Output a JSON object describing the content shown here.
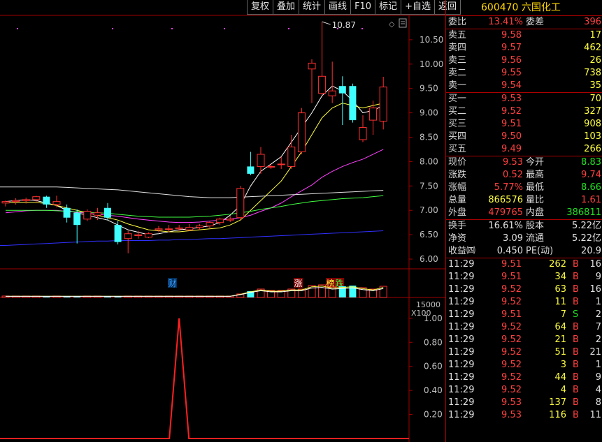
{
  "toolbar": {
    "buttons": [
      "复权",
      "叠加",
      "统计",
      "画线",
      "F10",
      "标记",
      "+自选",
      "返回"
    ]
  },
  "stock": {
    "code": "600470",
    "name": "六国化工"
  },
  "price_axis": [
    "10.50",
    "10.00",
    "9.50",
    "9.00",
    "8.50",
    "8.00",
    "7.50",
    "7.00",
    "6.50",
    "6.00"
  ],
  "high_marker": "10.87",
  "event_labels": [
    "财",
    "涨",
    "榜",
    "跌"
  ],
  "volume_axis": {
    "tick": "15000",
    "unit": "X100"
  },
  "indicator_axis": [
    "1.00",
    "0.80",
    "0.60",
    "0.40",
    "0.20"
  ],
  "wei": {
    "ratio_label": "委比",
    "ratio": "13.41%",
    "diff_label": "委差",
    "diff": "396"
  },
  "asks": [
    {
      "label": "卖五",
      "price": "9.58",
      "vol": "17"
    },
    {
      "label": "卖四",
      "price": "9.57",
      "vol": "462"
    },
    {
      "label": "卖三",
      "price": "9.56",
      "vol": "26"
    },
    {
      "label": "卖二",
      "price": "9.55",
      "vol": "738"
    },
    {
      "label": "卖一",
      "price": "9.54",
      "vol": "35"
    }
  ],
  "bids": [
    {
      "label": "买一",
      "price": "9.53",
      "vol": "70"
    },
    {
      "label": "买二",
      "price": "9.52",
      "vol": "327"
    },
    {
      "label": "买三",
      "price": "9.51",
      "vol": "908"
    },
    {
      "label": "买四",
      "price": "9.50",
      "vol": "103"
    },
    {
      "label": "买五",
      "price": "9.49",
      "vol": "266"
    }
  ],
  "quote": [
    {
      "l1": "现价",
      "v1": "9.53",
      "c1": "red",
      "l2": "今开",
      "v2": "8.83",
      "c2": "grn"
    },
    {
      "l1": "涨跌",
      "v1": "0.52",
      "c1": "red",
      "l2": "最高",
      "v2": "9.74",
      "c2": "red"
    },
    {
      "l1": "涨幅",
      "v1": "5.77%",
      "c1": "red",
      "l2": "最低",
      "v2": "8.66",
      "c2": "grn"
    },
    {
      "l1": "总量",
      "v1": "866576",
      "c1": "yel",
      "l2": "量比",
      "v2": "1.61",
      "c2": "red"
    },
    {
      "l1": "外盘",
      "v1": "479765",
      "c1": "red",
      "l2": "内盘",
      "v2": "386811",
      "c2": "grn"
    }
  ],
  "fund": [
    {
      "l1": "换手",
      "v1": "16.61%",
      "l2": "股本",
      "v2": "5.22亿"
    },
    {
      "l1": "净资",
      "v1": "3.09",
      "l2": "流通",
      "v2": "5.22亿"
    },
    {
      "l1": "收益㈣",
      "v1": "0.450",
      "l2": "PE(动)",
      "v2": "20.9"
    }
  ],
  "ticks": [
    {
      "time": "11:29",
      "price": "9.51",
      "vol": "262",
      "bs": "B",
      "n": "16",
      "pc": "red",
      "bc": "red"
    },
    {
      "time": "11:29",
      "price": "9.51",
      "vol": "34",
      "bs": "B",
      "n": "9",
      "pc": "red",
      "bc": "red"
    },
    {
      "time": "11:29",
      "price": "9.52",
      "vol": "63",
      "bs": "B",
      "n": "16",
      "pc": "red",
      "bc": "red"
    },
    {
      "time": "11:29",
      "price": "9.52",
      "vol": "11",
      "bs": "B",
      "n": "1",
      "pc": "red",
      "bc": "red"
    },
    {
      "time": "11:29",
      "price": "9.51",
      "vol": "7",
      "bs": "S",
      "n": "2",
      "pc": "red",
      "bc": "grn"
    },
    {
      "time": "11:29",
      "price": "9.52",
      "vol": "64",
      "bs": "B",
      "n": "7",
      "pc": "red",
      "bc": "red"
    },
    {
      "time": "11:29",
      "price": "9.52",
      "vol": "21",
      "bs": "B",
      "n": "2",
      "pc": "red",
      "bc": "red"
    },
    {
      "time": "11:29",
      "price": "9.52",
      "vol": "51",
      "bs": "B",
      "n": "21",
      "pc": "red",
      "bc": "red"
    },
    {
      "time": "11:29",
      "price": "9.52",
      "vol": "3",
      "bs": "B",
      "n": "1",
      "pc": "red",
      "bc": "red"
    },
    {
      "time": "11:29",
      "price": "9.52",
      "vol": "44",
      "bs": "B",
      "n": "9",
      "pc": "red",
      "bc": "red"
    },
    {
      "time": "11:29",
      "price": "9.52",
      "vol": "4",
      "bs": "B",
      "n": "4",
      "pc": "red",
      "bc": "red"
    },
    {
      "time": "11:29",
      "price": "9.53",
      "vol": "137",
      "bs": "B",
      "n": "8",
      "pc": "red",
      "bc": "red"
    },
    {
      "time": "11:29",
      "price": "9.53",
      "vol": "116",
      "bs": "B",
      "n": "11",
      "pc": "red",
      "bc": "red"
    }
  ],
  "colors": {
    "up": "#ff3030",
    "down": "#40ffff",
    "grid": "#a00000",
    "label": "#c0c0c0",
    "accent": "#ffd700"
  },
  "chart_data": {
    "type": "candlestick",
    "ylim": [
      5.8,
      11.0
    ],
    "candles": [
      {
        "o": 7.15,
        "h": 7.2,
        "l": 7.08,
        "c": 7.18
      },
      {
        "o": 7.18,
        "h": 7.25,
        "l": 7.12,
        "c": 7.2
      },
      {
        "o": 7.2,
        "h": 7.26,
        "l": 7.14,
        "c": 7.22
      },
      {
        "o": 7.22,
        "h": 7.3,
        "l": 7.16,
        "c": 7.28
      },
      {
        "o": 7.28,
        "h": 7.3,
        "l": 7.05,
        "c": 7.12
      },
      {
        "o": 7.12,
        "h": 7.3,
        "l": 7.06,
        "c": 7.18
      },
      {
        "o": 7.05,
        "h": 7.12,
        "l": 6.75,
        "c": 6.85
      },
      {
        "o": 6.95,
        "h": 7.02,
        "l": 6.32,
        "c": 6.7
      },
      {
        "o": 6.82,
        "h": 7.02,
        "l": 6.78,
        "c": 6.98
      },
      {
        "o": 6.9,
        "h": 7.05,
        "l": 6.8,
        "c": 6.95
      },
      {
        "o": 7.05,
        "h": 7.15,
        "l": 6.8,
        "c": 6.85
      },
      {
        "o": 6.7,
        "h": 6.78,
        "l": 6.3,
        "c": 6.35
      },
      {
        "o": 6.42,
        "h": 6.58,
        "l": 6.12,
        "c": 6.52
      },
      {
        "o": 6.48,
        "h": 6.58,
        "l": 6.42,
        "c": 6.5
      },
      {
        "o": 6.45,
        "h": 6.55,
        "l": 6.43,
        "c": 6.52
      },
      {
        "o": 6.6,
        "h": 6.68,
        "l": 6.55,
        "c": 6.62
      },
      {
        "o": 6.62,
        "h": 6.7,
        "l": 6.55,
        "c": 6.62
      },
      {
        "o": 6.62,
        "h": 6.7,
        "l": 6.58,
        "c": 6.64
      },
      {
        "o": 6.6,
        "h": 6.72,
        "l": 6.58,
        "c": 6.65
      },
      {
        "o": 6.65,
        "h": 6.72,
        "l": 6.6,
        "c": 6.68
      },
      {
        "o": 6.68,
        "h": 6.78,
        "l": 6.62,
        "c": 6.75
      },
      {
        "o": 6.75,
        "h": 6.85,
        "l": 6.7,
        "c": 6.82
      },
      {
        "o": 6.8,
        "h": 6.88,
        "l": 6.76,
        "c": 6.82
      },
      {
        "o": 6.85,
        "h": 7.5,
        "l": 6.8,
        "c": 7.45
      },
      {
        "o": 7.9,
        "h": 8.2,
        "l": 7.72,
        "c": 7.75
      },
      {
        "o": 7.9,
        "h": 8.3,
        "l": 7.75,
        "c": 8.15
      },
      {
        "o": 7.9,
        "h": 7.95,
        "l": 7.85,
        "c": 7.9
      },
      {
        "o": 7.95,
        "h": 8.1,
        "l": 7.85,
        "c": 7.95
      },
      {
        "o": 7.9,
        "h": 8.55,
        "l": 7.85,
        "c": 8.3
      },
      {
        "o": 8.2,
        "h": 9.1,
        "l": 8.15,
        "c": 9.0
      },
      {
        "o": 9.9,
        "h": 10.1,
        "l": 9.2,
        "c": 10.02
      },
      {
        "o": 9.4,
        "h": 10.87,
        "l": 9.35,
        "c": 9.75
      },
      {
        "o": 9.35,
        "h": 10.05,
        "l": 9.2,
        "c": 9.45
      },
      {
        "o": 9.55,
        "h": 9.75,
        "l": 8.75,
        "c": 9.4
      },
      {
        "o": 9.55,
        "h": 9.6,
        "l": 8.8,
        "c": 8.85
      },
      {
        "o": 8.45,
        "h": 8.95,
        "l": 8.4,
        "c": 8.7
      },
      {
        "o": 8.85,
        "h": 9.25,
        "l": 8.55,
        "c": 9.1
      },
      {
        "o": 8.83,
        "h": 9.74,
        "l": 8.66,
        "c": 9.53
      }
    ],
    "ma_lines": [
      {
        "name": "MA5",
        "color": "#ffffff",
        "values": [
          7.18,
          7.2,
          7.22,
          7.2,
          7.15,
          7.1,
          7.0,
          6.95,
          6.9,
          6.85,
          6.8,
          6.7,
          6.6,
          6.55,
          6.5,
          6.52,
          6.56,
          6.6,
          6.62,
          6.65,
          6.68,
          6.75,
          6.9,
          7.1,
          7.5,
          7.8,
          7.95,
          8.1,
          8.4,
          8.7,
          9.0,
          9.35,
          9.55,
          9.45,
          9.25,
          9.0,
          9.05,
          9.15
        ]
      },
      {
        "name": "MA10",
        "color": "#ffff40",
        "values": [
          7.15,
          7.16,
          7.17,
          7.16,
          7.14,
          7.1,
          7.05,
          7.0,
          6.95,
          6.9,
          6.85,
          6.8,
          6.72,
          6.66,
          6.6,
          6.58,
          6.56,
          6.56,
          6.58,
          6.6,
          6.62,
          6.64,
          6.7,
          6.8,
          7.0,
          7.2,
          7.4,
          7.6,
          7.9,
          8.2,
          8.55,
          8.9,
          9.1,
          9.2,
          9.15,
          9.1,
          9.15,
          9.2
        ]
      },
      {
        "name": "MA20",
        "color": "#ff40ff",
        "values": [
          6.95,
          6.97,
          6.99,
          7.0,
          7.0,
          7.0,
          6.98,
          6.96,
          6.94,
          6.92,
          6.9,
          6.88,
          6.85,
          6.82,
          6.8,
          6.78,
          6.76,
          6.75,
          6.75,
          6.76,
          6.78,
          6.8,
          6.82,
          6.85,
          6.9,
          6.98,
          7.05,
          7.15,
          7.28,
          7.4,
          7.52,
          7.68,
          7.8,
          7.9,
          7.98,
          8.05,
          8.15,
          8.25
        ]
      },
      {
        "name": "MA30",
        "color": "#40ff40",
        "values": [
          7.0,
          7.0,
          7.0,
          7.0,
          7.0,
          6.99,
          6.98,
          6.97,
          6.96,
          6.95,
          6.94,
          6.92,
          6.9,
          6.88,
          6.87,
          6.86,
          6.86,
          6.86,
          6.86,
          6.87,
          6.88,
          6.9,
          6.92,
          6.95,
          6.98,
          7.02,
          7.05,
          7.08,
          7.12,
          7.15,
          7.18,
          7.2,
          7.22,
          7.24,
          7.25,
          7.26,
          7.28,
          7.3
        ]
      },
      {
        "name": "MA60",
        "color": "#e0e0e0",
        "values": [
          7.48,
          7.48,
          7.48,
          7.48,
          7.48,
          7.48,
          7.47,
          7.46,
          7.45,
          7.44,
          7.43,
          7.42,
          7.4,
          7.38,
          7.36,
          7.34,
          7.32,
          7.3,
          7.28,
          7.27,
          7.26,
          7.26,
          7.26,
          7.27,
          7.28,
          7.29,
          7.3,
          7.31,
          7.32,
          7.33,
          7.34,
          7.35,
          7.36,
          7.37,
          7.38,
          7.39,
          7.4,
          7.41
        ]
      },
      {
        "name": "MA120",
        "color": "#3030ff",
        "values": [
          6.28,
          6.29,
          6.3,
          6.31,
          6.32,
          6.33,
          6.34,
          6.35,
          6.36,
          6.37,
          6.37,
          6.38,
          6.38,
          6.38,
          6.38,
          6.39,
          6.39,
          6.4,
          6.4,
          6.41,
          6.42,
          6.42,
          6.43,
          6.44,
          6.45,
          6.46,
          6.47,
          6.48,
          6.49,
          6.5,
          6.51,
          6.52,
          6.53,
          6.54,
          6.55,
          6.56,
          6.57,
          6.58
        ]
      }
    ],
    "volume_rel": [
      0.1,
      0.1,
      0.1,
      0.1,
      0.1,
      0.1,
      0.1,
      0.1,
      0.1,
      0.1,
      0.1,
      0.1,
      0.1,
      0.1,
      0.1,
      0.1,
      0.1,
      0.1,
      0.1,
      0.1,
      0.1,
      0.1,
      0.1,
      0.25,
      0.45,
      0.6,
      0.5,
      0.5,
      0.6,
      0.6,
      0.85,
      0.9,
      0.75,
      0.8,
      0.85,
      0.7,
      0.6,
      0.8
    ],
    "indicator": {
      "ylim": [
        0,
        1.15
      ],
      "spike_index": 17,
      "spike_value": 1.0
    }
  }
}
